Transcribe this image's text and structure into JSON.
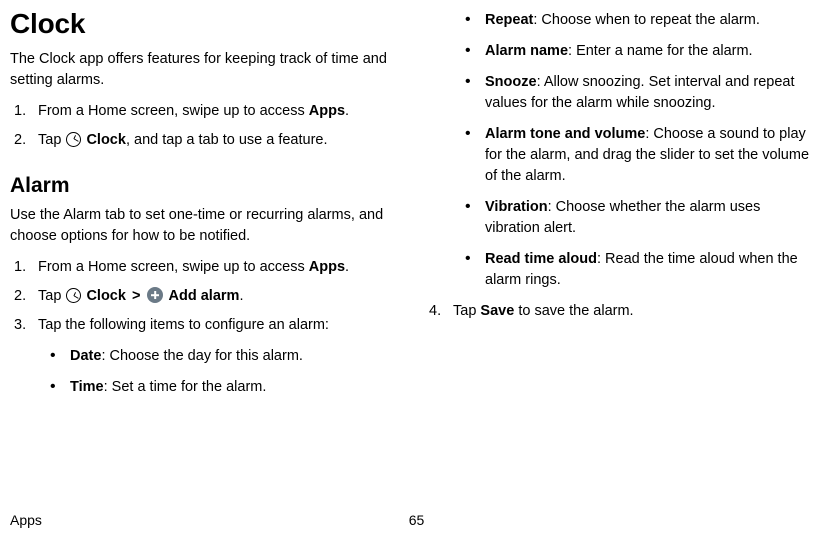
{
  "title": "Clock",
  "intro": "The Clock app offers features for keeping track of time and setting alarms.",
  "top_steps": [
    {
      "pre": "From a Home screen, swipe up to access ",
      "bold": "Apps",
      "post": "."
    },
    {
      "pre": "Tap ",
      "icon": "clock-outline",
      "iconLabel": "Clock",
      "post2": ", and tap a tab to use a feature."
    }
  ],
  "alarm_heading": "Alarm",
  "alarm_intro": "Use the Alarm tab to set one-time or recurring alarms, and choose options for how to be notified.",
  "alarm_steps_left": [
    {
      "type": "apps",
      "pre": "From a Home screen, swipe up to access ",
      "bold": "Apps",
      "post": "."
    },
    {
      "type": "clock_add",
      "pre": "Tap ",
      "iconLabel1": "Clock",
      "sep": " > ",
      "iconLabel2": "Add alarm",
      "post": "."
    },
    {
      "type": "plain",
      "text": "Tap the following items to configure an alarm:"
    }
  ],
  "left_bullets": [
    {
      "label": "Date",
      "desc": ": Choose the day for this alarm."
    },
    {
      "label": "Time",
      "desc": ": Set a time for the alarm."
    }
  ],
  "right_bullets": [
    {
      "label": "Repeat",
      "desc": ": Choose when to repeat the alarm."
    },
    {
      "label": "Alarm name",
      "desc": ": Enter a name for the alarm."
    },
    {
      "label": "Snooze",
      "desc": ": Allow snoozing. Set interval and repeat values for the alarm while snoozing."
    },
    {
      "label": "Alarm tone and volume",
      "desc": ": Choose a sound to play for the alarm, and drag the slider to set the volume of the alarm."
    },
    {
      "label": "Vibration",
      "desc": ": Choose whether the alarm uses vibration alert."
    },
    {
      "label": "Read time aloud",
      "desc": ": Read the time aloud when the alarm rings."
    }
  ],
  "step4": {
    "num": "4.",
    "pre": "Tap ",
    "bold": "Save",
    "post": " to save the alarm."
  },
  "footer": {
    "section": "Apps",
    "page": "65"
  }
}
